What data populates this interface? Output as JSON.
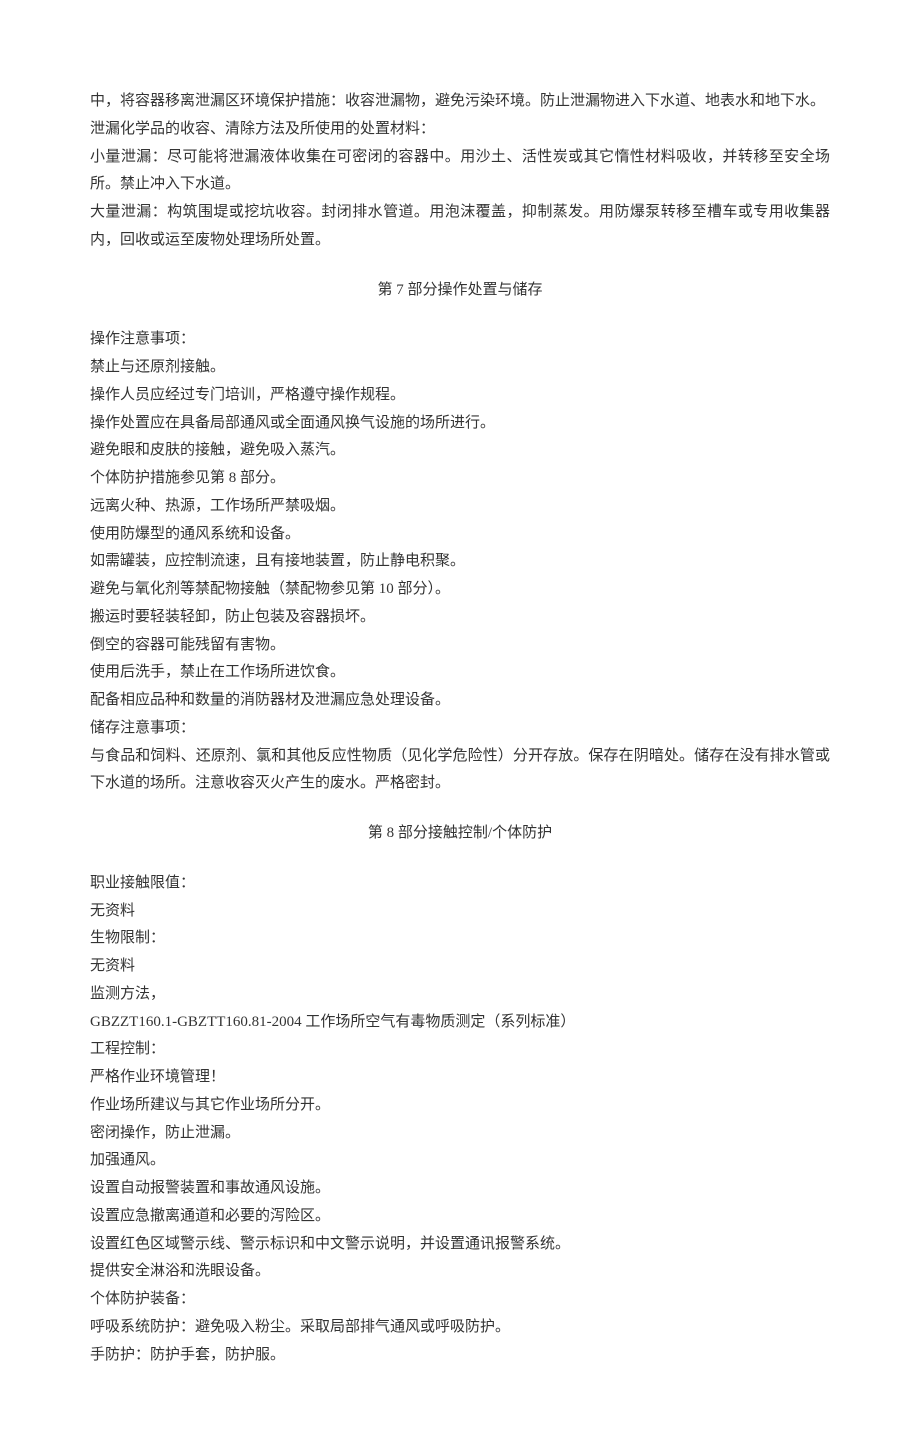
{
  "section6": {
    "p1": "中，将容器移离泄漏区环境保护措施：收容泄漏物，避免污染环境。防止泄漏物进入下水道、地表水和地下水。",
    "p2": "泄漏化学品的收容、清除方法及所使用的处置材料：",
    "p3": "小量泄漏：尽可能将泄漏液体收集在可密闭的容器中。用沙土、活性炭或其它惰性材料吸收，并转移至安全场所。禁止冲入下水道。",
    "p4": "大量泄漏：构筑围堤或挖坑收容。封闭排水管道。用泡沫覆盖，抑制蒸发。用防爆泵转移至槽车或专用收集器内，回收或运至废物处理场所处置。"
  },
  "section7": {
    "title": "第 7 部分操作处置与储存",
    "p1": "操作注意事项：",
    "p2": "禁止与还原剂接触。",
    "p3": "操作人员应经过专门培训，严格遵守操作规程。",
    "p4": "操作处置应在具备局部通风或全面通风换气设施的场所进行。",
    "p5": "避免眼和皮肤的接触，避免吸入蒸汽。",
    "p6": "个体防护措施参见第 8 部分。",
    "p7": "远离火种、热源，工作场所严禁吸烟。",
    "p8": "使用防爆型的通风系统和设备。",
    "p9": "如需罐装，应控制流速，且有接地装置，防止静电积聚。",
    "p10": "避免与氧化剂等禁配物接触（禁配物参见第 10 部分）。",
    "p11": "搬运时要轻装轻卸，防止包装及容器损坏。",
    "p12": "倒空的容器可能残留有害物。",
    "p13": "使用后洗手，禁止在工作场所进饮食。",
    "p14": "配备相应品种和数量的消防器材及泄漏应急处理设备。",
    "p15": "储存注意事项：",
    "p16": "与食品和饲料、还原剂、氯和其他反应性物质（见化学危险性）分开存放。保存在阴暗处。储存在没有排水管或下水道的场所。注意收容灭火产生的废水。严格密封。"
  },
  "section8": {
    "title": "第 8 部分接触控制/个体防护",
    "p1": "职业接触限值：",
    "p2": "无资料",
    "p3": "生物限制：",
    "p4": "无资料",
    "p5": "监测方法，",
    "p6": "GBZZT160.1-GBZTT160.81-2004 工作场所空气有毒物质测定（系列标准）",
    "p7": "工程控制：",
    "p8": "严格作业环境管理！",
    "p9": "作业场所建议与其它作业场所分开。",
    "p10": "密闭操作，防止泄漏。",
    "p11": "加强通风。",
    "p12": "设置自动报警装置和事故通风设施。",
    "p13": "设置应急撤离通道和必要的泻险区。",
    "p14": "设置红色区域警示线、警示标识和中文警示说明，并设置通讯报警系统。",
    "p15": "提供安全淋浴和洗眼设备。",
    "p16": "个体防护装备：",
    "p17": "呼吸系统防护：避免吸入粉尘。采取局部排气通风或呼吸防护。",
    "p18": "手防护：防护手套，防护服。"
  }
}
